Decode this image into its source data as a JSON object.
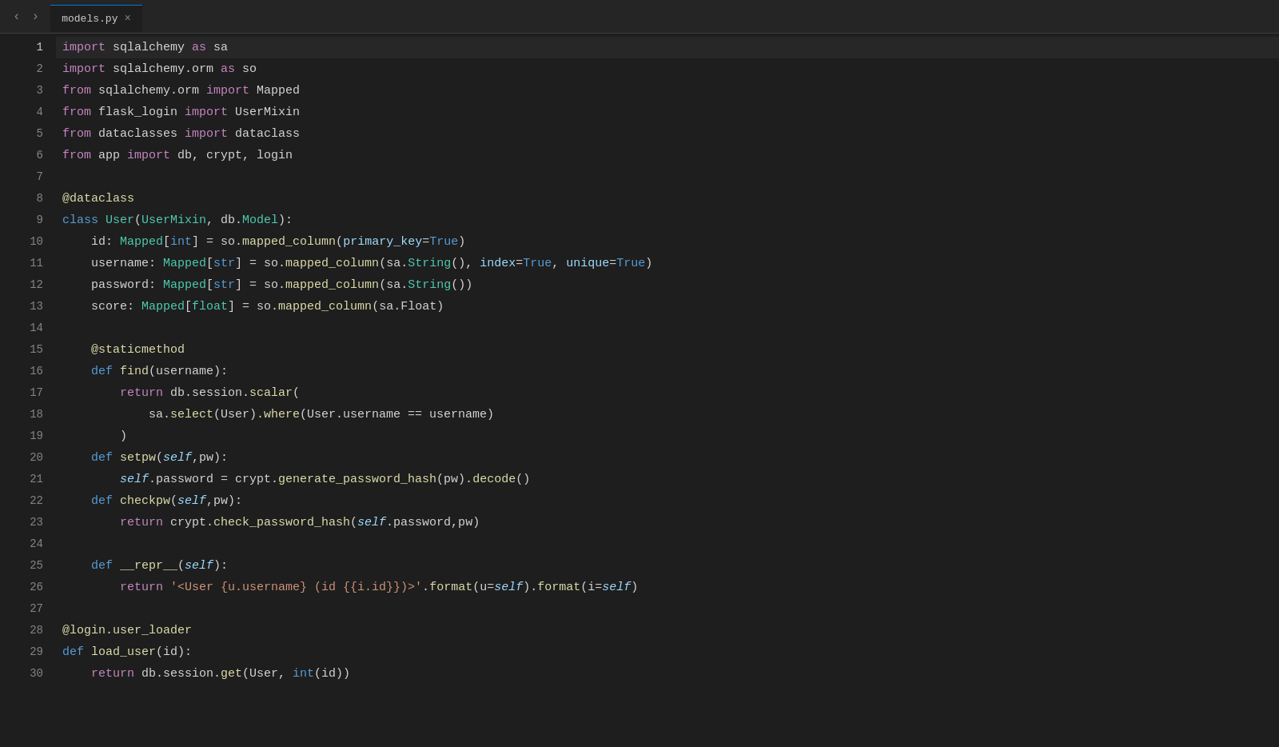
{
  "titleBar": {
    "filename": "models.py",
    "closeIcon": "×"
  },
  "navArrows": {
    "back": "‹",
    "forward": "›"
  },
  "lines": [
    {
      "num": 1,
      "active": true
    },
    {
      "num": 2
    },
    {
      "num": 3
    },
    {
      "num": 4
    },
    {
      "num": 5
    },
    {
      "num": 6
    },
    {
      "num": 7
    },
    {
      "num": 8
    },
    {
      "num": 9
    },
    {
      "num": 10
    },
    {
      "num": 11
    },
    {
      "num": 12
    },
    {
      "num": 13
    },
    {
      "num": 14
    },
    {
      "num": 15
    },
    {
      "num": 16
    },
    {
      "num": 17
    },
    {
      "num": 18
    },
    {
      "num": 19
    },
    {
      "num": 20
    },
    {
      "num": 21
    },
    {
      "num": 22
    },
    {
      "num": 23
    },
    {
      "num": 24
    },
    {
      "num": 25
    },
    {
      "num": 26
    },
    {
      "num": 27
    },
    {
      "num": 28
    },
    {
      "num": 29
    },
    {
      "num": 30
    }
  ]
}
